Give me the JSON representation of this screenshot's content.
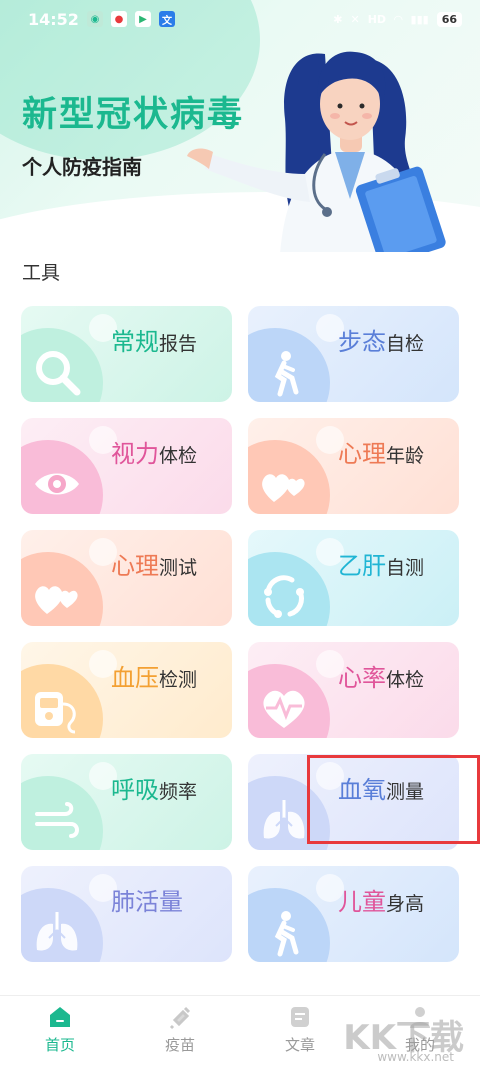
{
  "status_bar": {
    "time": "14:52",
    "battery": "66",
    "net_label": "HD"
  },
  "banner": {
    "title": "新型冠状病毒",
    "subtitle": "个人防疫指南"
  },
  "section": {
    "title": "工具"
  },
  "tools": [
    {
      "hl": "常规",
      "rest": "报告",
      "hl_color": "#1bb88f",
      "bg_from": "#e6faf3",
      "bg_to": "#cdf3e6",
      "blob": "#bff0df",
      "icon": "magnifier-icon"
    },
    {
      "hl": "步态",
      "rest": "自检",
      "hl_color": "#5a7fd8",
      "bg_from": "#e9f1fd",
      "bg_to": "#d4e5fb",
      "blob": "#bcd6f8",
      "icon": "walking-person-icon"
    },
    {
      "hl": "视力",
      "rest": "体检",
      "hl_color": "#e0559a",
      "bg_from": "#fdeef5",
      "bg_to": "#fbdbea",
      "blob": "#f9bcd8",
      "icon": "eye-icon"
    },
    {
      "hl": "心理",
      "rest": "年龄",
      "hl_color": "#ee7a55",
      "bg_from": "#fff0ea",
      "bg_to": "#ffe0d5",
      "blob": "#ffc8b6",
      "icon": "hearts-icon"
    },
    {
      "hl": "心理",
      "rest": "测试",
      "hl_color": "#ee7a55",
      "bg_from": "#fff0ea",
      "bg_to": "#ffe0d5",
      "blob": "#ffc8b6",
      "icon": "hearts-icon"
    },
    {
      "hl": "乙肝",
      "rest": "自测",
      "hl_color": "#20b5d4",
      "bg_from": "#e5f8fb",
      "bg_to": "#cbf0f6",
      "blob": "#abe5f1",
      "icon": "virus-cycle-icon"
    },
    {
      "hl": "血压",
      "rest": "检测",
      "hl_color": "#f3a032",
      "bg_from": "#fff6e8",
      "bg_to": "#ffebcd",
      "blob": "#ffd9a5",
      "icon": "blood-pressure-icon"
    },
    {
      "hl": "心率",
      "rest": "体检",
      "hl_color": "#e0559a",
      "bg_from": "#fdeef5",
      "bg_to": "#fbdbea",
      "blob": "#f9bcd8",
      "icon": "heart-pulse-icon"
    },
    {
      "hl": "呼吸",
      "rest": "频率",
      "hl_color": "#1bb88f",
      "bg_from": "#e6faf3",
      "bg_to": "#cdf3e6",
      "blob": "#bff0df",
      "icon": "wind-icon"
    },
    {
      "hl": "血氧",
      "rest": "测量",
      "hl_color": "#5a7fd8",
      "bg_from": "#eef1fd",
      "bg_to": "#dde4fb",
      "blob": "#cdd8f8",
      "icon": "lungs-icon"
    },
    {
      "hl": "肺活量",
      "rest": "",
      "hl_color": "#7b83d8",
      "bg_from": "#eef1fd",
      "bg_to": "#dde4fb",
      "blob": "#cdd8f8",
      "icon": "lungs-icon"
    },
    {
      "hl": "儿童",
      "rest": "身高",
      "hl_color": "#e0559a",
      "bg_from": "#e9f1fd",
      "bg_to": "#d4e5fb",
      "blob": "#bcd6f8",
      "icon": "walking-person-icon"
    }
  ],
  "bottom_nav": [
    {
      "label": "首页",
      "icon": "home-icon",
      "active": true
    },
    {
      "label": "疫苗",
      "icon": "syringe-icon",
      "active": false
    },
    {
      "label": "文章",
      "icon": "article-icon",
      "active": false
    },
    {
      "label": "我的",
      "icon": "profile-icon",
      "active": false
    }
  ],
  "watermark": {
    "text": "KK下载",
    "url": "www.kkx.net"
  },
  "colors": {
    "accent": "#1bb88f",
    "highlight_box": "#e8393c"
  }
}
